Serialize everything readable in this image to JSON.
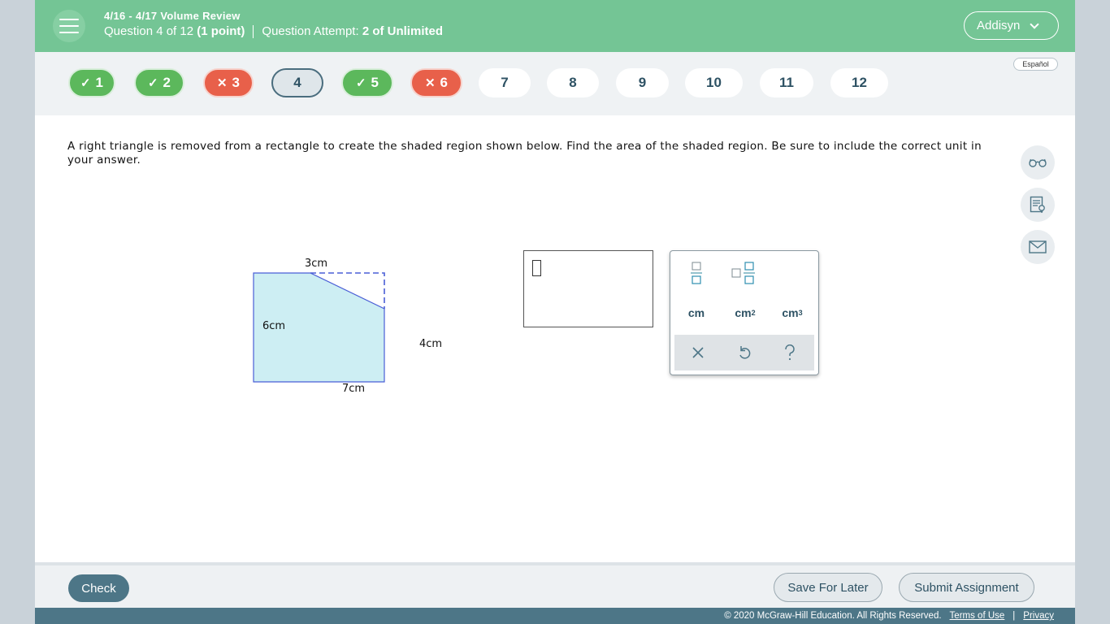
{
  "header": {
    "title": "4/16 - 4/17 Volume Review",
    "question_label": "Question 4 of 12",
    "points": "(1 point)",
    "attempt_label": "Question Attempt:",
    "attempt_value": "2 of Unlimited",
    "user_name": "Addisyn"
  },
  "nav": {
    "language_label": "Español",
    "questions": [
      {
        "num": "1",
        "status": "correct",
        "mark": "✓"
      },
      {
        "num": "2",
        "status": "correct",
        "mark": "✓"
      },
      {
        "num": "3",
        "status": "wrong",
        "mark": "✕"
      },
      {
        "num": "4",
        "status": "current",
        "mark": ""
      },
      {
        "num": "5",
        "status": "correct",
        "mark": "✓"
      },
      {
        "num": "6",
        "status": "wrong",
        "mark": "✕"
      },
      {
        "num": "7",
        "status": "todo",
        "mark": ""
      },
      {
        "num": "8",
        "status": "todo",
        "mark": ""
      },
      {
        "num": "9",
        "status": "todo",
        "mark": ""
      },
      {
        "num": "10",
        "status": "todo",
        "mark": ""
      },
      {
        "num": "11",
        "status": "todo",
        "mark": ""
      },
      {
        "num": "12",
        "status": "todo",
        "mark": ""
      }
    ]
  },
  "question": {
    "text": "A right triangle is removed from a rectangle to create the shaded region shown below. Find the area of the shaded region. Be sure to include the correct unit in your answer."
  },
  "figure": {
    "label_top": "3cm",
    "label_left": "6cm",
    "label_right": "4cm",
    "label_bottom": "7cm",
    "fill_color": "#cdeef3",
    "stroke_color": "#4a5ed6"
  },
  "keypad": {
    "unit_cm": "cm",
    "unit_cm2_base": "cm",
    "unit_cm2_exp": "2",
    "unit_cm3_base": "cm",
    "unit_cm3_exp": "3",
    "icons": [
      "fraction-icon",
      "mixed-number-icon",
      "clear-icon",
      "undo-icon",
      "help-icon"
    ]
  },
  "tools": [
    "glasses-icon",
    "notes-icon",
    "mail-icon"
  ],
  "footer": {
    "check_label": "Check",
    "save_label": "Save For Later",
    "submit_label": "Submit Assignment",
    "copyright": "© 2020 McGraw-Hill Education. All Rights Reserved.",
    "terms_label": "Terms of Use",
    "divider": "|",
    "privacy_label": "Privacy"
  },
  "colors": {
    "header_green": "#74c595",
    "correct": "#5cb85c",
    "wrong": "#e8604a",
    "primary": "#4d7687"
  }
}
